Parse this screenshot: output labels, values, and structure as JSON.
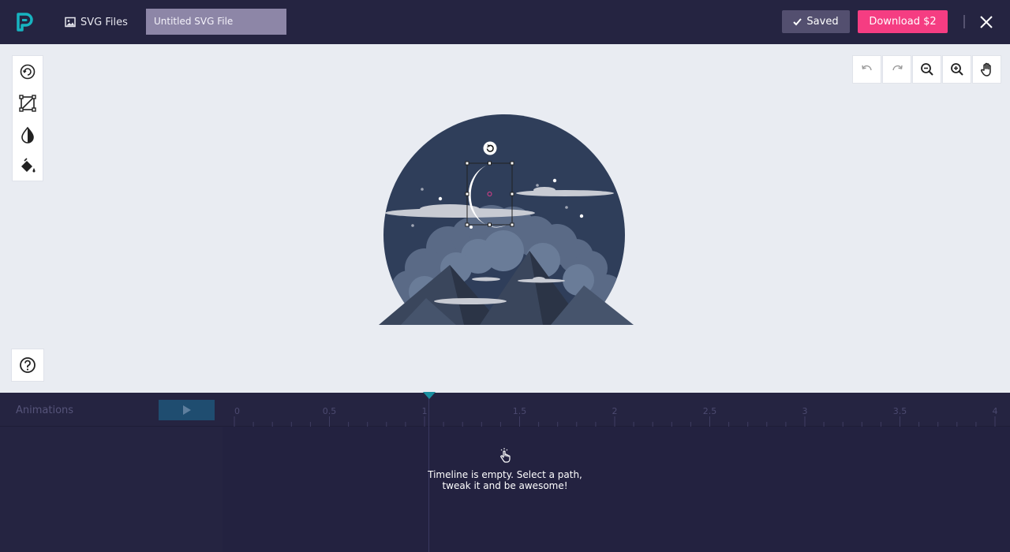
{
  "header": {
    "svg_files_label": "SVG Files",
    "file_name": "Untitled SVG File",
    "saved_label": "Saved",
    "download_label": "Download $2"
  },
  "colors": {
    "topbar": "#252441",
    "accent_teal": "#17b3c0",
    "download_pink": "#f53d82",
    "canvas_bg": "#e9ecf2"
  },
  "tools": {
    "icons": [
      "rotate-tool-icon",
      "transform-tool-icon",
      "opacity-tool-icon",
      "fill-tool-icon"
    ]
  },
  "view_tools": {
    "icons": [
      "undo-icon",
      "redo-icon",
      "zoom-out-icon",
      "zoom-in-icon",
      "hand-pan-icon"
    ]
  },
  "timeline": {
    "animations_label": "Animations",
    "ruler_ticks": [
      "0",
      "0.5",
      "1",
      "1.5",
      "2",
      "2.5",
      "3",
      "3.5",
      "4"
    ],
    "empty_line1": "Timeline is empty. Select a path,",
    "empty_line2": "tweak it and be awesome!"
  }
}
